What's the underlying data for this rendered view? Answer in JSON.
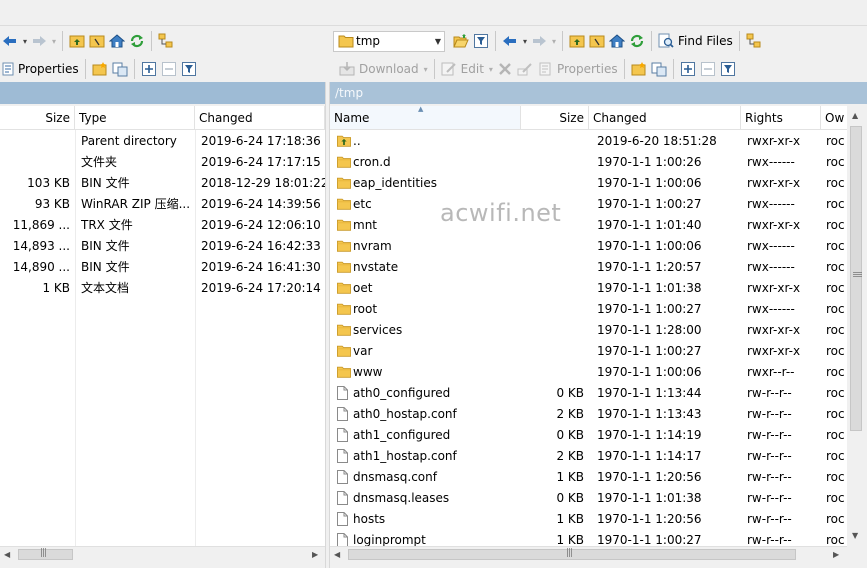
{
  "left_toolbar_top": {
    "back_label": "",
    "forward_label": ""
  },
  "left_toolbar_bottom": {
    "properties_label": "Properties"
  },
  "right_toolbar_top": {
    "path_value": "tmp",
    "find_files_label": "Find Files"
  },
  "right_toolbar_bottom": {
    "download_label": "Download",
    "edit_label": "Edit",
    "properties_label": "Properties"
  },
  "right_pane": {
    "path": "/tmp"
  },
  "left_columns": {
    "size": "Size",
    "type": "Type",
    "changed": "Changed"
  },
  "left_rows": [
    {
      "size": "",
      "type": "Parent directory",
      "changed": "2019-6-24   17:18:36"
    },
    {
      "size": "",
      "type": "文件夹",
      "changed": "2019-6-24   17:17:15"
    },
    {
      "size": "103 KB",
      "type": "BIN 文件",
      "changed": "2018-12-29   18:01:22"
    },
    {
      "size": "93 KB",
      "type": "WinRAR ZIP 压缩...",
      "changed": "2019-6-24   14:39:56"
    },
    {
      "size": "11,869 ...",
      "type": "TRX 文件",
      "changed": "2019-6-24   12:06:10"
    },
    {
      "size": "14,893 ...",
      "type": "BIN 文件",
      "changed": "2019-6-24   16:42:33"
    },
    {
      "size": "14,890 ...",
      "type": "BIN 文件",
      "changed": "2019-6-24   16:41:30"
    },
    {
      "size": "1 KB",
      "type": "文本文档",
      "changed": "2019-6-24   17:20:14"
    }
  ],
  "right_columns": {
    "name": "Name",
    "size": "Size",
    "changed": "Changed",
    "rights": "Rights",
    "owner": "Ow"
  },
  "right_rows": [
    {
      "kind": "up",
      "name": "..",
      "size": "",
      "changed": "2019-6-20 18:51:28",
      "rights": "rwxr-xr-x",
      "owner": "roc"
    },
    {
      "kind": "folder",
      "name": "cron.d",
      "size": "",
      "changed": "1970-1-1 1:00:26",
      "rights": "rwx------",
      "owner": "roc"
    },
    {
      "kind": "folder",
      "name": "eap_identities",
      "size": "",
      "changed": "1970-1-1 1:00:06",
      "rights": "rwxr-xr-x",
      "owner": "roc"
    },
    {
      "kind": "folder",
      "name": "etc",
      "size": "",
      "changed": "1970-1-1 1:00:27",
      "rights": "rwx------",
      "owner": "roc"
    },
    {
      "kind": "folder",
      "name": "mnt",
      "size": "",
      "changed": "1970-1-1 1:01:40",
      "rights": "rwxr-xr-x",
      "owner": "roc"
    },
    {
      "kind": "folder",
      "name": "nvram",
      "size": "",
      "changed": "1970-1-1 1:00:06",
      "rights": "rwx------",
      "owner": "roc"
    },
    {
      "kind": "folder",
      "name": "nvstate",
      "size": "",
      "changed": "1970-1-1 1:20:57",
      "rights": "rwx------",
      "owner": "roc"
    },
    {
      "kind": "folder",
      "name": "oet",
      "size": "",
      "changed": "1970-1-1 1:01:38",
      "rights": "rwxr-xr-x",
      "owner": "roc"
    },
    {
      "kind": "folder",
      "name": "root",
      "size": "",
      "changed": "1970-1-1 1:00:27",
      "rights": "rwx------",
      "owner": "roc"
    },
    {
      "kind": "folder",
      "name": "services",
      "size": "",
      "changed": "1970-1-1 1:28:00",
      "rights": "rwxr-xr-x",
      "owner": "roc"
    },
    {
      "kind": "folder",
      "name": "var",
      "size": "",
      "changed": "1970-1-1 1:00:27",
      "rights": "rwxr-xr-x",
      "owner": "roc"
    },
    {
      "kind": "folder",
      "name": "www",
      "size": "",
      "changed": "1970-1-1 1:00:06",
      "rights": "rwxr--r--",
      "owner": "roc"
    },
    {
      "kind": "file",
      "name": "ath0_configured",
      "size": "0 KB",
      "changed": "1970-1-1 1:13:44",
      "rights": "rw-r--r--",
      "owner": "roc"
    },
    {
      "kind": "file",
      "name": "ath0_hostap.conf",
      "size": "2 KB",
      "changed": "1970-1-1 1:13:43",
      "rights": "rw-r--r--",
      "owner": "roc"
    },
    {
      "kind": "file",
      "name": "ath1_configured",
      "size": "0 KB",
      "changed": "1970-1-1 1:14:19",
      "rights": "rw-r--r--",
      "owner": "roc"
    },
    {
      "kind": "file",
      "name": "ath1_hostap.conf",
      "size": "2 KB",
      "changed": "1970-1-1 1:14:17",
      "rights": "rw-r--r--",
      "owner": "roc"
    },
    {
      "kind": "file",
      "name": "dnsmasq.conf",
      "size": "1 KB",
      "changed": "1970-1-1 1:20:56",
      "rights": "rw-r--r--",
      "owner": "roc"
    },
    {
      "kind": "file",
      "name": "dnsmasq.leases",
      "size": "0 KB",
      "changed": "1970-1-1 1:01:38",
      "rights": "rw-r--r--",
      "owner": "roc"
    },
    {
      "kind": "file",
      "name": "hosts",
      "size": "1 KB",
      "changed": "1970-1-1 1:20:56",
      "rights": "rw-r--r--",
      "owner": "roc"
    },
    {
      "kind": "file",
      "name": "loginprompt",
      "size": "1 KB",
      "changed": "1970-1-1 1:00:27",
      "rights": "rw-r--r--",
      "owner": "roc"
    }
  ],
  "watermark": "acwifi.net",
  "colors": {
    "left_header": "#9ebbd5",
    "right_header": "#a9c2d8",
    "folder": "#f4c64e",
    "toolbar_green": "#2f9e3a",
    "toolbar_blue": "#2a6ebf"
  }
}
